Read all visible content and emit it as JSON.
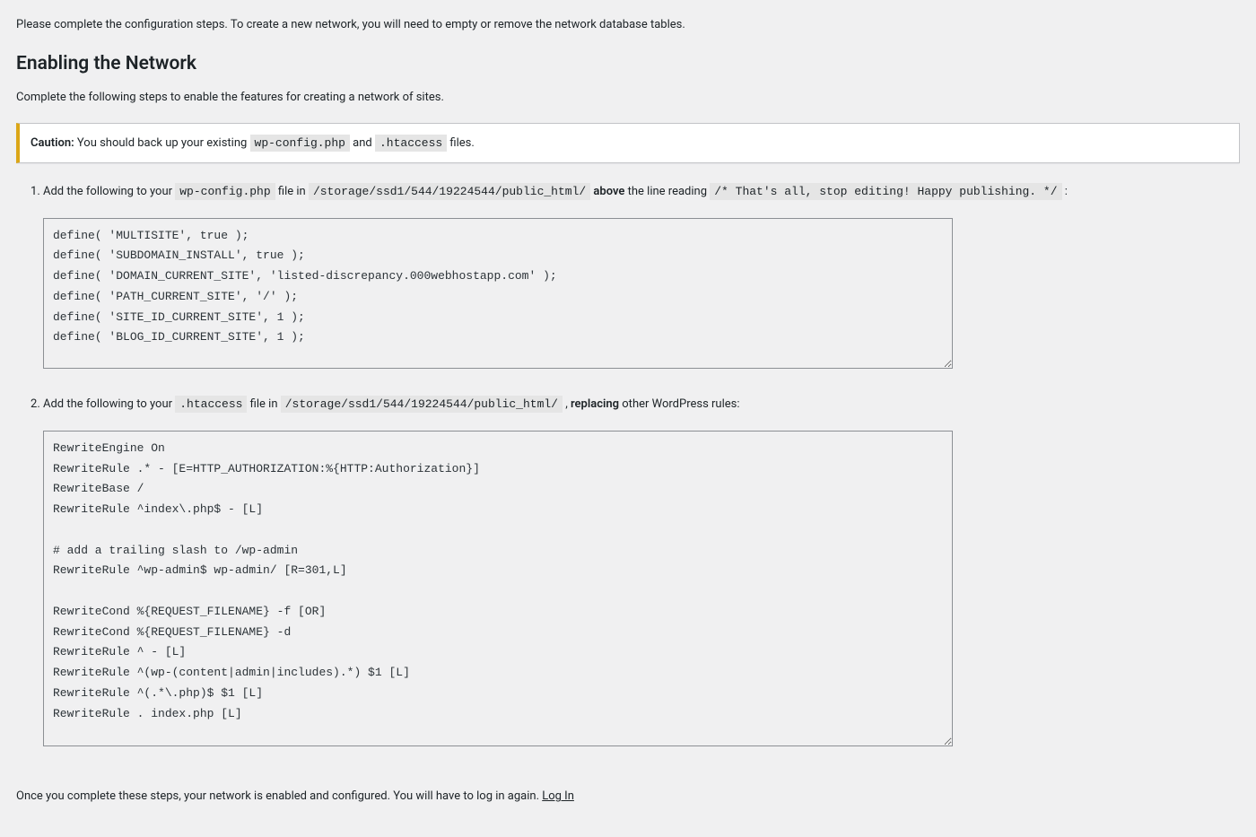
{
  "intro": "Please complete the configuration steps. To create a new network, you will need to empty or remove the network database tables.",
  "heading": "Enabling the Network",
  "subtitle": "Complete the following steps to enable the features for creating a network of sites.",
  "notice": {
    "caution_label": "Caution:",
    "before1": " You should back up your existing ",
    "file1": "wp-config.php",
    "mid": " and ",
    "file2": ".htaccess",
    "after": " files."
  },
  "step1": {
    "prefix": "Add the following to your ",
    "file": "wp-config.php",
    "mid1": " file in ",
    "path": "/storage/ssd1/544/19224544/public_html/",
    "mid2": " ",
    "above": "above",
    "mid3": " the line reading ",
    "stopline": "/* That's all, stop editing! Happy publishing. */",
    "suffix": " :"
  },
  "code1": "define( 'MULTISITE', true );\ndefine( 'SUBDOMAIN_INSTALL', true );\ndefine( 'DOMAIN_CURRENT_SITE', 'listed-discrepancy.000webhostapp.com' );\ndefine( 'PATH_CURRENT_SITE', '/' );\ndefine( 'SITE_ID_CURRENT_SITE', 1 );\ndefine( 'BLOG_ID_CURRENT_SITE', 1 );\n",
  "step2": {
    "prefix": "Add the following to your ",
    "file": ".htaccess",
    "mid1": " file in ",
    "path": "/storage/ssd1/544/19224544/public_html/",
    "mid2": " , ",
    "replacing": "replacing",
    "suffix": " other WordPress rules:"
  },
  "code2": "RewriteEngine On\nRewriteRule .* - [E=HTTP_AUTHORIZATION:%{HTTP:Authorization}]\nRewriteBase /\nRewriteRule ^index\\.php$ - [L]\n\n# add a trailing slash to /wp-admin\nRewriteRule ^wp-admin$ wp-admin/ [R=301,L]\n\nRewriteCond %{REQUEST_FILENAME} -f [OR]\nRewriteCond %{REQUEST_FILENAME} -d\nRewriteRule ^ - [L]\nRewriteRule ^(wp-(content|admin|includes).*) $1 [L]\nRewriteRule ^(.*\\.php)$ $1 [L]\nRewriteRule . index.php [L]\n",
  "footer": {
    "text": "Once you complete these steps, your network is enabled and configured. You will have to log in again. ",
    "link": "Log In"
  }
}
